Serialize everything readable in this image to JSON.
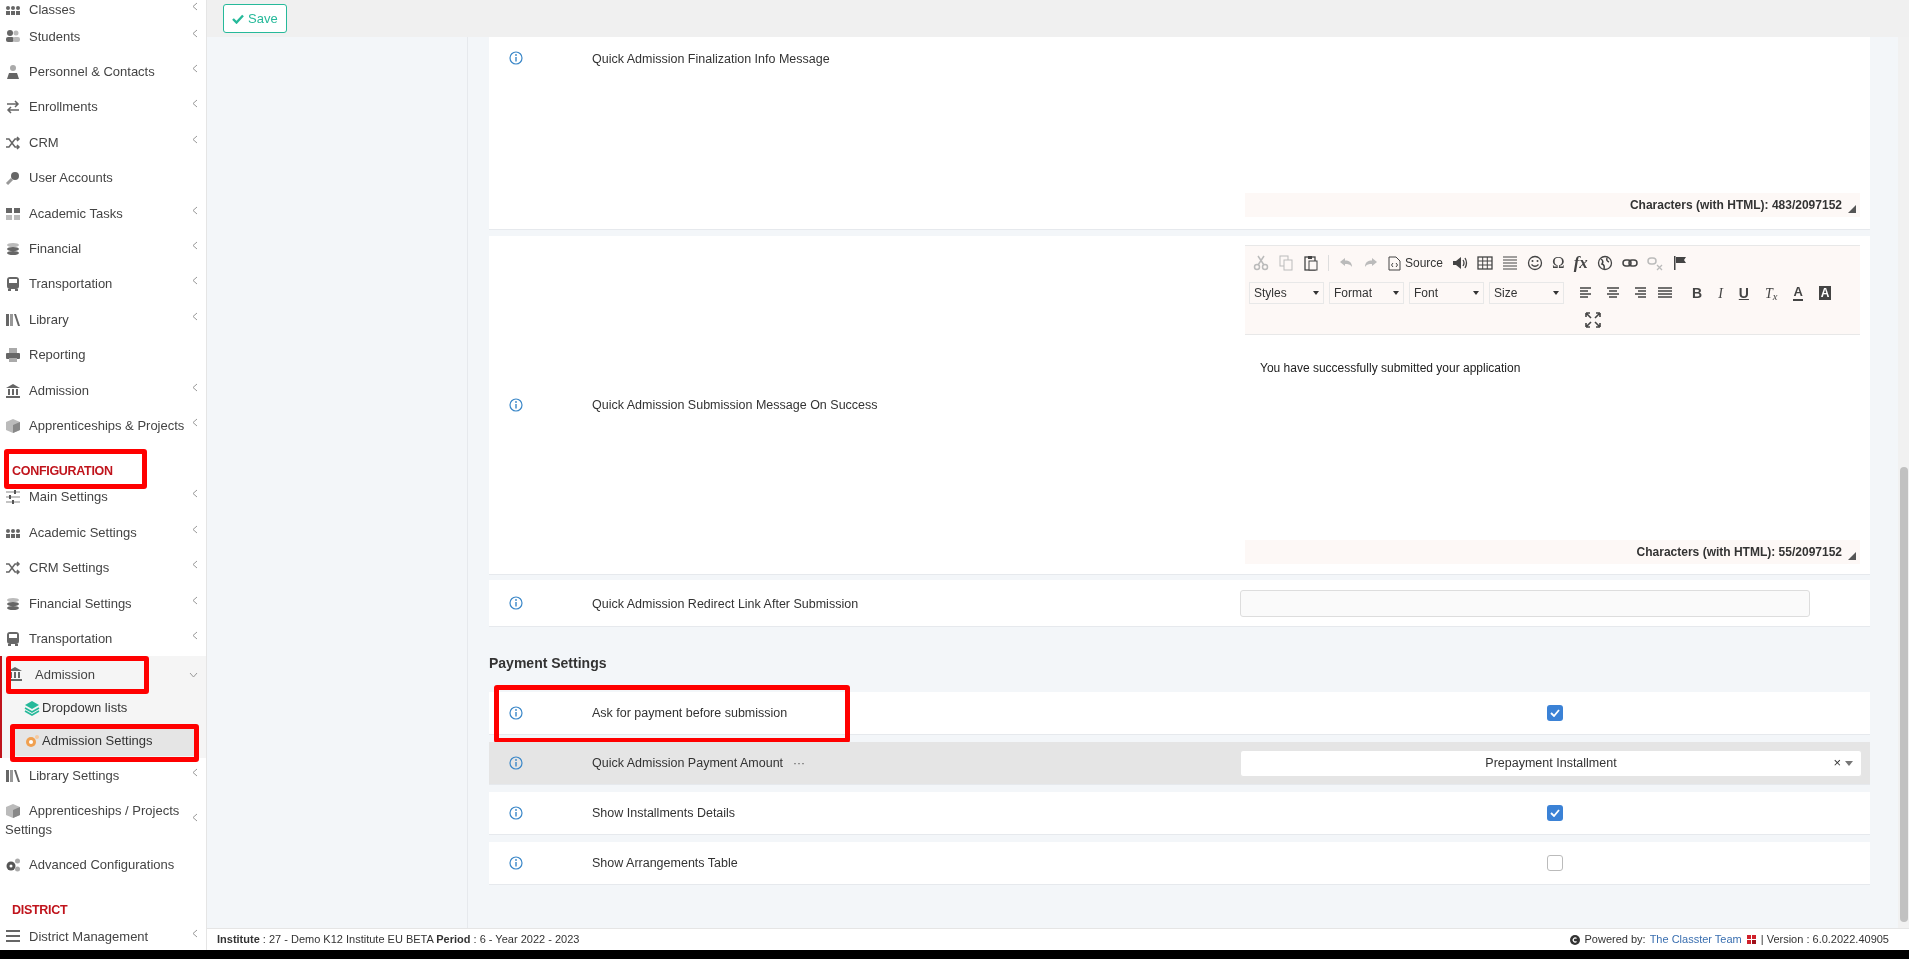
{
  "sidebar": {
    "sections": [
      {
        "items": [
          {
            "label": "Classes",
            "submenu": true,
            "expanded": false,
            "highlighted": false
          },
          {
            "label": "Students",
            "submenu": true,
            "expanded": false,
            "highlighted": false
          },
          {
            "label": "Personnel & Contacts",
            "submenu": true,
            "expanded": false,
            "highlighted": false
          },
          {
            "label": "Enrollments",
            "submenu": true,
            "expanded": false,
            "highlighted": false
          },
          {
            "label": "CRM",
            "submenu": true,
            "expanded": false,
            "highlighted": false
          },
          {
            "label": "User Accounts",
            "submenu": false,
            "expanded": false,
            "highlighted": false
          },
          {
            "label": "Academic Tasks",
            "submenu": true,
            "expanded": false,
            "highlighted": false
          },
          {
            "label": "Financial",
            "submenu": true,
            "expanded": false,
            "highlighted": false
          },
          {
            "label": "Transportation",
            "submenu": true,
            "expanded": false,
            "highlighted": false
          },
          {
            "label": "Library",
            "submenu": true,
            "expanded": false,
            "highlighted": false
          },
          {
            "label": "Reporting",
            "submenu": false,
            "expanded": false,
            "highlighted": false
          },
          {
            "label": "Admission",
            "submenu": true,
            "expanded": false,
            "highlighted": false
          },
          {
            "label": "Apprenticeships & Projects",
            "submenu": true,
            "expanded": false,
            "highlighted": false
          }
        ]
      },
      {
        "heading": "CONFIGURATION",
        "highlighted": true,
        "items": [
          {
            "label": "Main Settings",
            "submenu": true,
            "expanded": false,
            "highlighted": false
          },
          {
            "label": "Academic Settings",
            "submenu": true,
            "expanded": false,
            "highlighted": false
          },
          {
            "label": "CRM Settings",
            "submenu": true,
            "expanded": false,
            "highlighted": false
          },
          {
            "label": "Financial Settings",
            "submenu": true,
            "expanded": false,
            "highlighted": false
          },
          {
            "label": "Transportation",
            "submenu": true,
            "expanded": false,
            "highlighted": false
          },
          {
            "label": "Admission",
            "submenu": true,
            "expanded": true,
            "highlighted": true,
            "children": [
              {
                "label": "Dropdown lists",
                "selected": false,
                "highlighted": false
              },
              {
                "label": "Admission Settings",
                "selected": true,
                "highlighted": true
              }
            ]
          },
          {
            "label": "Library Settings",
            "submenu": true,
            "expanded": false,
            "highlighted": false
          },
          {
            "label": "Apprenticeships / Projects Settings",
            "submenu": true,
            "expanded": false,
            "highlighted": false
          },
          {
            "label": "Advanced Configurations",
            "submenu": false,
            "expanded": false,
            "highlighted": false
          }
        ]
      },
      {
        "heading": "DISTRICT",
        "highlighted": false,
        "items": [
          {
            "label": "District Management",
            "submenu": true,
            "expanded": false,
            "highlighted": false
          }
        ]
      }
    ]
  },
  "toolbar": {
    "save_button": "Save"
  },
  "settings": [
    {
      "kind": "editor",
      "label": "Quick Admission Finalization Info Message",
      "char_count": "Characters (with HTML): 483/2097152"
    },
    {
      "kind": "editor",
      "label": "Quick Admission Submission Message On Success",
      "editor_toolbar": {
        "source": "Source",
        "symbol": "Ω",
        "formula": "fx",
        "dropdowns": [
          "Styles",
          "Format",
          "Font",
          "Size"
        ],
        "bold": "B",
        "italic": "I",
        "underline": "U",
        "clear_format": "T$_{x}$",
        "text_color": "A",
        "background_color": "A"
      },
      "content": "You have successfully submitted your application",
      "char_count": "Characters (with HTML): 55/2097152"
    },
    {
      "kind": "text",
      "label": "Quick Admission Redirect Link After Submission"
    }
  ],
  "payment_settings": {
    "title": "Payment Settings",
    "rows": [
      {
        "kind": "checkbox",
        "label": "Ask for payment before submission",
        "checked": true,
        "hovered": false,
        "highlighted": true
      },
      {
        "kind": "select",
        "label": "Quick Admission Payment Amount",
        "label_suffix": "···",
        "value": "Prepayment Installment",
        "clear": "×",
        "hovered": true,
        "highlighted": false
      },
      {
        "kind": "checkbox",
        "label": "Show Installments Details",
        "checked": true,
        "hovered": false,
        "highlighted": false
      },
      {
        "kind": "checkbox",
        "label": "Show Arrangements Table",
        "checked": false,
        "hovered": false,
        "highlighted": false
      }
    ]
  },
  "footer": {
    "info": "**Institute** : 27 - Demo K12 Institute EU BETA **Period** : 6 - Year 2022 - 2023",
    "powered_by": "Powered by:",
    "team_link": "The Classter Team",
    "version": "| Version : 6.0.2022.40905"
  }
}
